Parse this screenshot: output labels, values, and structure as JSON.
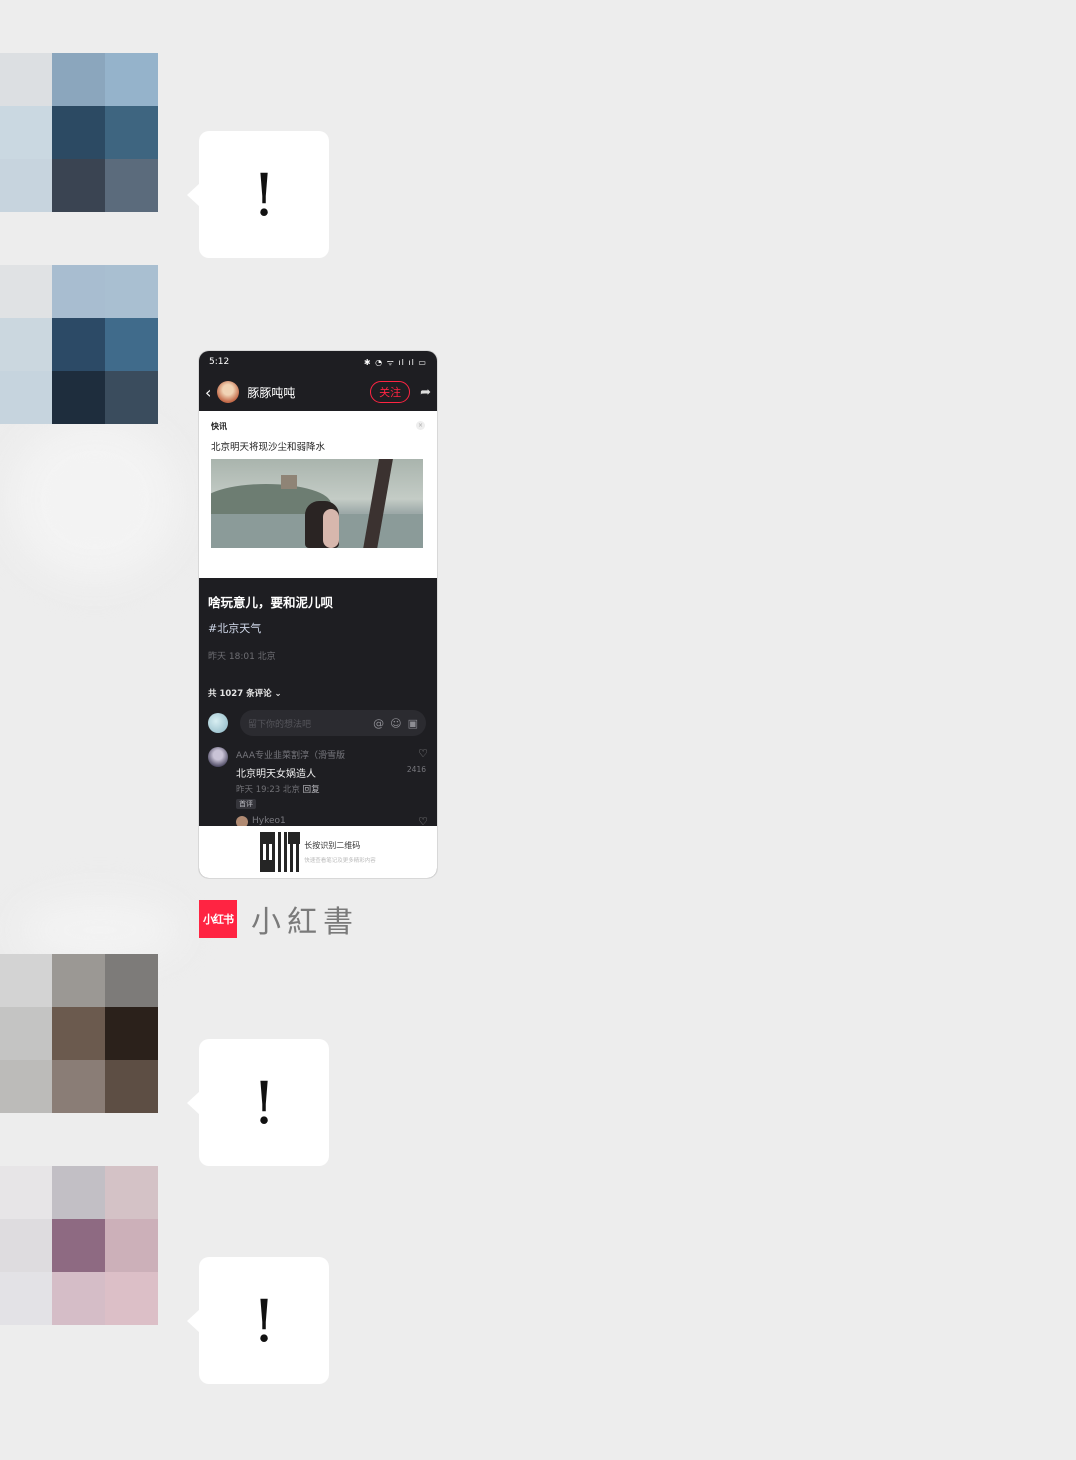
{
  "chat": {
    "messages": [
      {
        "type": "text",
        "text": "!"
      },
      {
        "type": "shared-card"
      },
      {
        "type": "text",
        "text": "!"
      },
      {
        "type": "text",
        "text": "!"
      }
    ]
  },
  "shared_card": {
    "status_time": "5:12",
    "status_icons": "✱ ◔ ᯤ ıl ıl ▭",
    "author_name": "豚豚吨吨",
    "follow_label": "关注",
    "news_tag": "快讯",
    "news_title": "北京明天将现沙尘和弱降水",
    "post_title": "啥玩意儿，要和泥儿呗",
    "post_hashtag": "#北京天气",
    "post_meta": "昨天 18:01 北京",
    "comment_count": "共 1027 条评论 ⌄",
    "comment_placeholder": "留下你的想法吧",
    "comment": {
      "user": "AAA专业韭菜割淳（滑雪版",
      "text": "北京明天女娲造人",
      "meta_time": "昨天 19:23 北京",
      "meta_reply": "回复",
      "badge": "首评",
      "likes": "2416"
    },
    "reply_user": "Hykeo1",
    "qr_title": "长按识别二维码",
    "qr_subtitle": "快速查看笔记及更多精彩内容"
  },
  "brand": {
    "logo_text": "小红书",
    "name": "小紅書"
  },
  "colors": {
    "background": "#ededed",
    "bubble": "#ffffff",
    "accent": "#ff2442",
    "card_dark": "#1e1e22"
  }
}
